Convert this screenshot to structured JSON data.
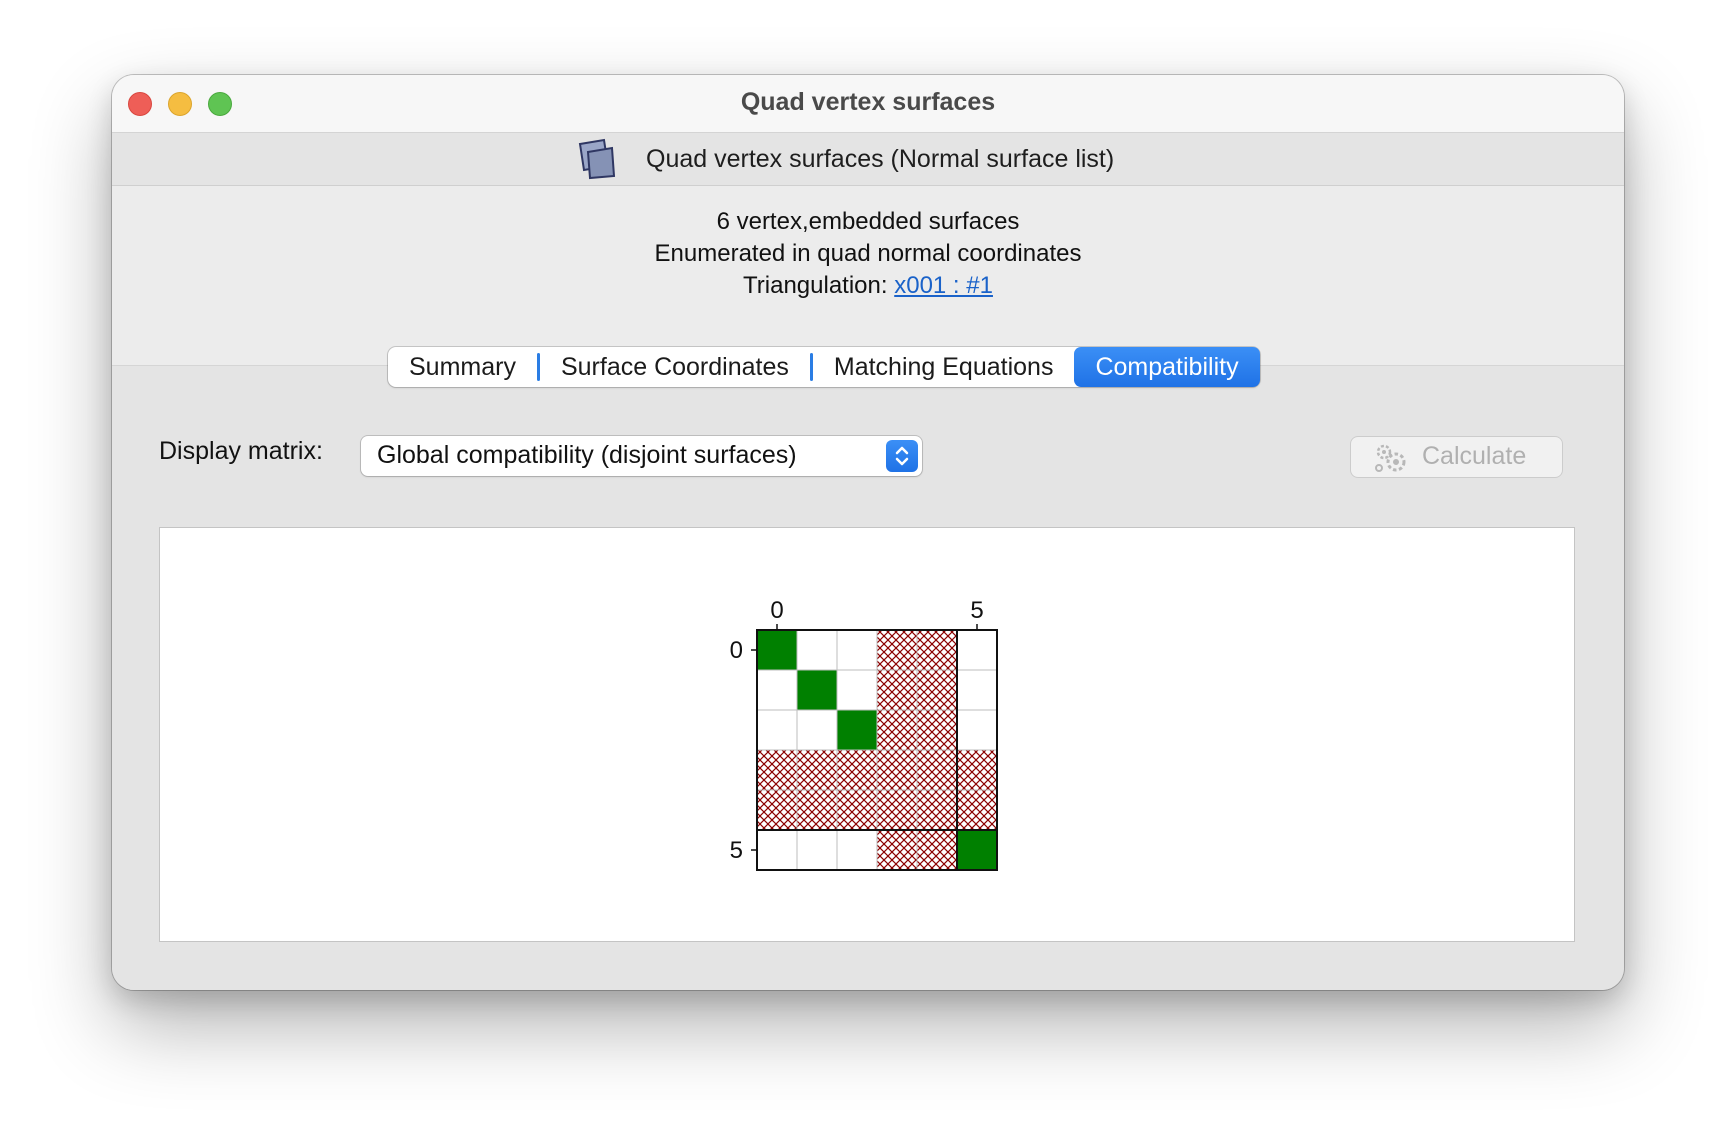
{
  "window": {
    "title": "Quad vertex surfaces"
  },
  "header": {
    "icon": "normal-surface-list-icon",
    "text": "Quad vertex surfaces (Normal surface list)"
  },
  "info": {
    "line1": "6 vertex,embedded surfaces",
    "line2": "Enumerated in quad normal coordinates",
    "triangulation_label": "Triangulation: ",
    "triangulation_link": "x001 : #1"
  },
  "tabs": [
    {
      "label": "Summary",
      "active": false
    },
    {
      "label": "Surface Coordinates",
      "active": false
    },
    {
      "label": "Matching Equations",
      "active": false
    },
    {
      "label": "Compatibility",
      "active": true
    }
  ],
  "controls": {
    "display_label": "Display matrix:",
    "display_value": "Global compatibility (disjoint surfaces)",
    "calculate_label": "Calculate",
    "calculate_enabled": false
  },
  "matrix": {
    "size": 6,
    "tick_labels": {
      "0": "0",
      "5": "5"
    },
    "compatible_cells": [
      [
        0,
        0
      ],
      [
        1,
        1
      ],
      [
        2,
        2
      ],
      [
        5,
        5
      ]
    ],
    "hatched_indices": [
      3,
      4
    ],
    "colors": {
      "compatible": "#008000",
      "incompatible_hatch": "#8b0000",
      "empty": "#ffffff"
    }
  }
}
